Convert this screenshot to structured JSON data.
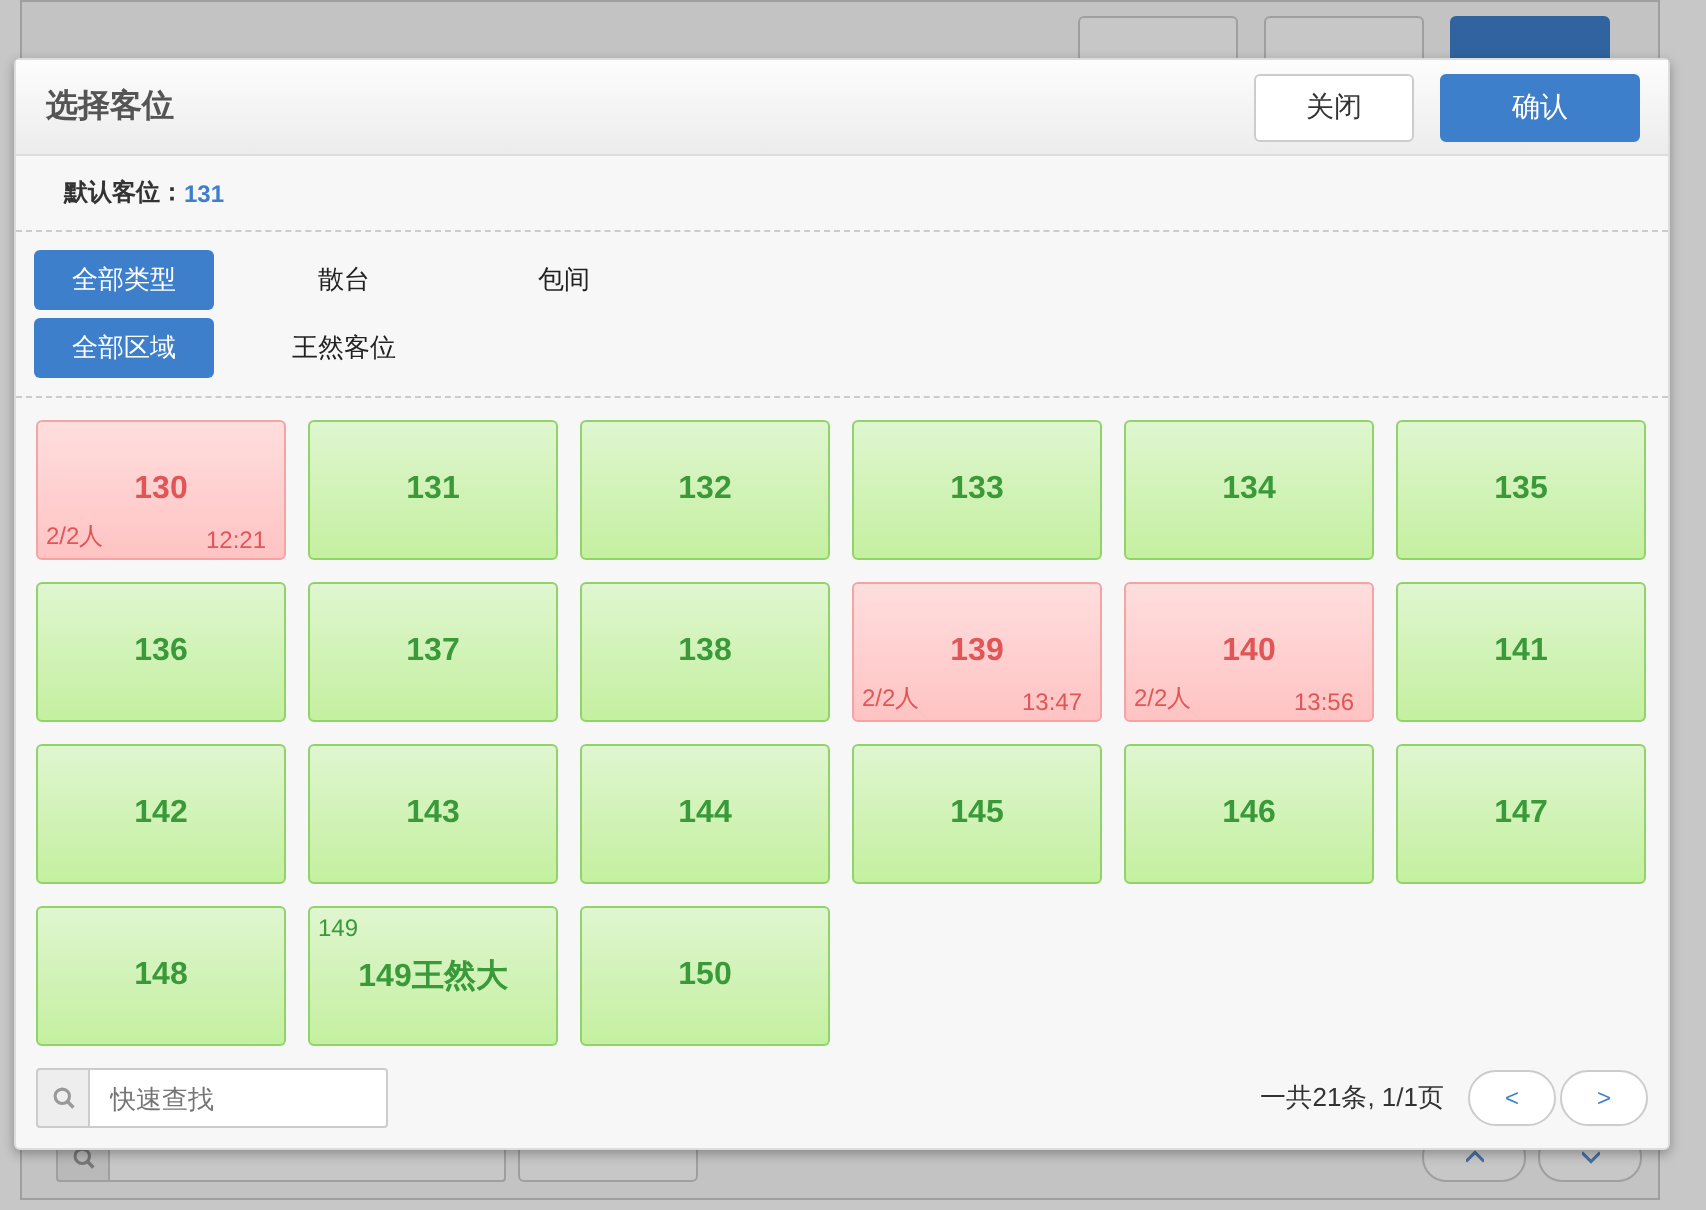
{
  "background_window": {
    "buttons": [
      {
        "primary": false
      },
      {
        "primary": false
      },
      {
        "primary": true
      }
    ]
  },
  "dialog": {
    "title": "选择客位",
    "buttons": [
      {
        "label": "关闭",
        "primary": false
      },
      {
        "label": "确认",
        "primary": true
      }
    ],
    "default_seat": {
      "label": "默认客位：",
      "value": "131"
    },
    "type_filters": [
      {
        "label": "全部类型",
        "selected": true
      },
      {
        "label": "散台",
        "selected": false
      },
      {
        "label": "包间",
        "selected": false
      }
    ],
    "area_filters": [
      {
        "label": "全部区域",
        "selected": true
      },
      {
        "label": "王然客位",
        "selected": false
      }
    ],
    "seats": [
      {
        "number": "130",
        "kind": "occupied",
        "people": "2/2人",
        "time": "12:21"
      },
      {
        "number": "131",
        "kind": "free"
      },
      {
        "number": "132",
        "kind": "free"
      },
      {
        "number": "133",
        "kind": "free"
      },
      {
        "number": "134",
        "kind": "free"
      },
      {
        "number": "135",
        "kind": "free"
      },
      {
        "number": "136",
        "kind": "free"
      },
      {
        "number": "137",
        "kind": "free"
      },
      {
        "number": "138",
        "kind": "free"
      },
      {
        "number": "139",
        "kind": "occupied",
        "people": "2/2人",
        "time": "13:47"
      },
      {
        "number": "140",
        "kind": "occupied",
        "people": "2/2人",
        "time": "13:56"
      },
      {
        "number": "141",
        "kind": "free"
      },
      {
        "number": "142",
        "kind": "free"
      },
      {
        "number": "143",
        "kind": "free"
      },
      {
        "number": "144",
        "kind": "free"
      },
      {
        "number": "145",
        "kind": "free"
      },
      {
        "number": "146",
        "kind": "free"
      },
      {
        "number": "147",
        "kind": "free"
      },
      {
        "number": "148",
        "kind": "free"
      },
      {
        "number": "149王然大",
        "kind": "free",
        "tag": "149"
      },
      {
        "number": "150",
        "kind": "free"
      }
    ],
    "search": {
      "placeholder": "快速查找"
    },
    "pagination": {
      "summary": "一共21条, 1/1页",
      "prev": "<",
      "next": ">"
    }
  }
}
